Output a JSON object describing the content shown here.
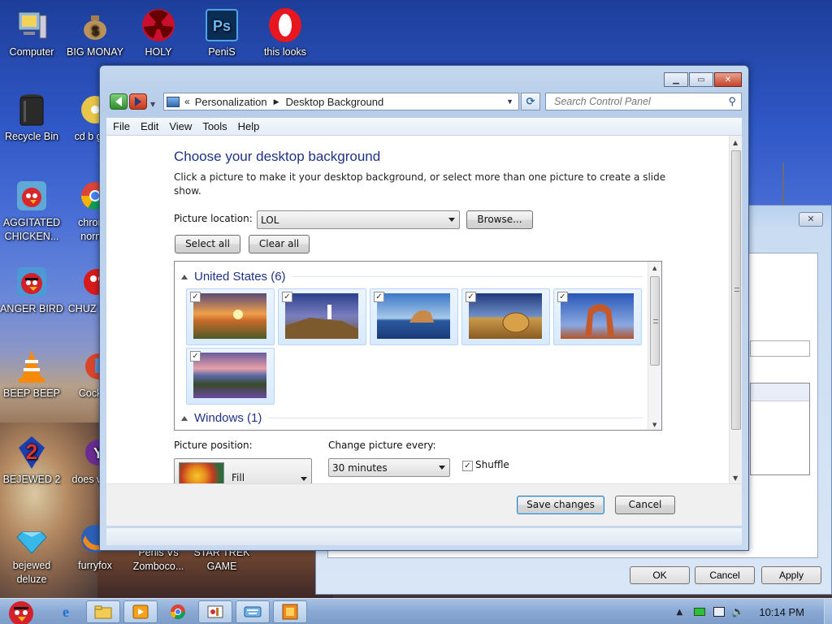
{
  "desktop": {
    "icons": [
      {
        "label": "Computer"
      },
      {
        "label": "BIG MONAY"
      },
      {
        "label": "HOLY"
      },
      {
        "label": "PeniS"
      },
      {
        "label": "this looks"
      },
      {
        "label": "Recycle Bin"
      },
      {
        "label": "cd b gold"
      },
      {
        "label": "AGGITATED CHICKEN..."
      },
      {
        "label": "chrome norma"
      },
      {
        "label": "ANGER BIRD"
      },
      {
        "label": "CHUZ MY J"
      },
      {
        "label": "BEEP BEEP"
      },
      {
        "label": "CockCl"
      },
      {
        "label": "BEJEWED 2"
      },
      {
        "label": "does work"
      },
      {
        "label": "bejewed deluze"
      },
      {
        "label": "furryfox"
      },
      {
        "label": "Penis Vs Zomboco..."
      },
      {
        "label": "STAR TREK GAME"
      }
    ]
  },
  "window": {
    "address": {
      "chevron": "«",
      "crumb1": "Personalization",
      "separator": "▶",
      "crumb2": "Desktop Background"
    },
    "search_placeholder": "Search Control Panel",
    "menu": [
      "File",
      "Edit",
      "View",
      "Tools",
      "Help"
    ],
    "heading": "Choose your desktop background",
    "description": "Click a picture to make it your desktop background, or select more than one picture to create a slide show.",
    "picture_location_label": "Picture location:",
    "picture_location_value": "LOL",
    "browse_label": "Browse...",
    "select_all_label": "Select all",
    "clear_all_label": "Clear all",
    "groups": [
      {
        "title": "United States (6)"
      },
      {
        "title": "Windows (1)"
      }
    ],
    "thumbnails": [
      {
        "name": "sunset-field",
        "checked": true
      },
      {
        "name": "lighthouse",
        "checked": true
      },
      {
        "name": "sea-rock",
        "checked": true
      },
      {
        "name": "hay-bale",
        "checked": true
      },
      {
        "name": "delicate-arch",
        "checked": true
      },
      {
        "name": "lupine-lake",
        "checked": true
      }
    ],
    "picture_position_label": "Picture position:",
    "picture_position_value": "Fill",
    "change_picture_label": "Change picture every:",
    "change_picture_value": "30 minutes",
    "shuffle_label": "Shuffle",
    "shuffle_checked": true,
    "save_label": "Save changes",
    "cancel_label": "Cancel"
  },
  "secondary_window": {
    "ok_label": "OK",
    "cancel_label": "Cancel",
    "apply_label": "Apply"
  },
  "taskbar": {
    "clock": "10:14 PM"
  },
  "checkmark": "✓"
}
